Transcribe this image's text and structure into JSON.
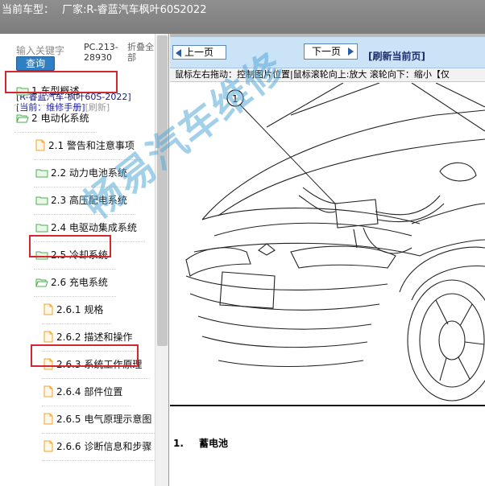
{
  "titlebar": {
    "current_model_label": "当前车型：",
    "manufacturer": "厂家:R-睿蓝汽车枫叶60S2022"
  },
  "left_panel": {
    "search_placeholder": "输入关键字",
    "query_button": "查询",
    "code": "PC.213-28930",
    "collapse_all": "折叠全部",
    "breadcrumb": {
      "model": "[R-睿蓝汽车-枫叶60S-2022]",
      "current_prefix": "[当前：维修手册]",
      "refresh": "[刷新]"
    }
  },
  "tree": [
    {
      "label": "1 车型概述",
      "type": "folder-closed",
      "highlighted": false
    },
    {
      "label": "2 电动化系统",
      "type": "folder-open",
      "highlighted": true
    },
    {
      "label": "2.1 警告和注意事项",
      "type": "doc",
      "highlighted": false
    },
    {
      "label": "2.2 动力电池系统",
      "type": "folder-closed",
      "highlighted": false
    },
    {
      "label": "2.3 高压配电系统",
      "type": "folder-closed",
      "highlighted": false
    },
    {
      "label": "2.4 电驱动集成系统",
      "type": "folder-closed",
      "highlighted": false
    },
    {
      "label": "2.5 冷却系统",
      "type": "folder-closed",
      "highlighted": false
    },
    {
      "label": "2.6 充电系统",
      "type": "folder-open",
      "highlighted": true
    },
    {
      "label": "2.6.1 规格",
      "type": "doc",
      "highlighted": false
    },
    {
      "label": "2.6.2 描述和操作",
      "type": "doc",
      "highlighted": false
    },
    {
      "label": "2.6.3 系统工作原理",
      "type": "doc",
      "highlighted": false
    },
    {
      "label": "2.6.4 部件位置",
      "type": "doc",
      "highlighted": true
    },
    {
      "label": "2.6.5 电气原理示意图",
      "type": "doc",
      "highlighted": false
    },
    {
      "label": "2.6.6 诊断信息和步骤",
      "type": "doc",
      "highlighted": false
    }
  ],
  "viewer": {
    "prev_label": "上一页",
    "next_label": "下一页",
    "refresh_label": "[刷新当前页]",
    "hint": "鼠标左右拖动：控制图片位置|鼠标滚轮向上:放大  滚轮向下：缩小【仅",
    "callout_number": "1",
    "caption_number": "1.",
    "caption_text": "蓄电池",
    "watermark": "畅易汽车维修"
  },
  "colors": {
    "titlebar": "#8a8a8a",
    "navbar": "#cbe3f6",
    "highlight": "#d5282e",
    "folder": "#4caf50",
    "doc": "#f0a030",
    "query_button": "#2e7fc4",
    "watermark": "#58aad7"
  }
}
